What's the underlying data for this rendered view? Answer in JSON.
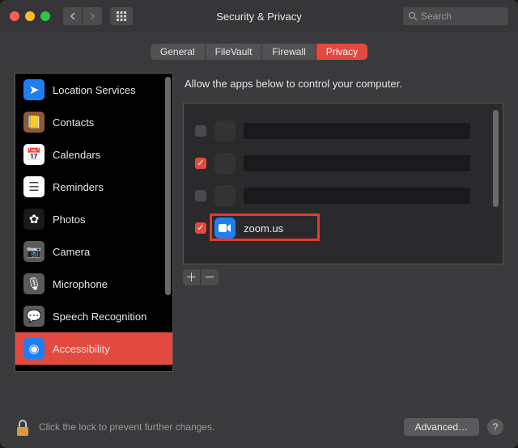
{
  "window": {
    "title": "Security & Privacy"
  },
  "search": {
    "placeholder": "Search"
  },
  "tabs": [
    {
      "id": "general",
      "label": "General",
      "active": false
    },
    {
      "id": "filevault",
      "label": "FileVault",
      "active": false
    },
    {
      "id": "firewall",
      "label": "Firewall",
      "active": false
    },
    {
      "id": "privacy",
      "label": "Privacy",
      "active": true
    }
  ],
  "sidebar": {
    "items": [
      {
        "id": "location",
        "label": "Location Services",
        "icon_bg": "#1f7ef0",
        "glyph": "➤"
      },
      {
        "id": "contacts",
        "label": "Contacts",
        "icon_bg": "#8a5a3a",
        "glyph": "📒"
      },
      {
        "id": "calendars",
        "label": "Calendars",
        "icon_bg": "#ffffff",
        "glyph": "📅"
      },
      {
        "id": "reminders",
        "label": "Reminders",
        "icon_bg": "#ffffff",
        "glyph": "☰"
      },
      {
        "id": "photos",
        "label": "Photos",
        "icon_bg": "#1a1a1a",
        "glyph": "✿"
      },
      {
        "id": "camera",
        "label": "Camera",
        "icon_bg": "#5a5a5c",
        "glyph": "📷"
      },
      {
        "id": "microphone",
        "label": "Microphone",
        "icon_bg": "#5a5a5c",
        "glyph": "🎙"
      },
      {
        "id": "speech",
        "label": "Speech Recognition",
        "icon_bg": "#5a5a5c",
        "glyph": "💬"
      },
      {
        "id": "accessibility",
        "label": "Accessibility",
        "icon_bg": "#1f7ef0",
        "glyph": "◉",
        "selected": true
      }
    ]
  },
  "main": {
    "description": "Allow the apps below to control your computer.",
    "apps": [
      {
        "checked": false,
        "redacted": true
      },
      {
        "checked": true,
        "redacted": true
      },
      {
        "checked": false,
        "redacted": true
      },
      {
        "checked": true,
        "name": "zoom.us",
        "icon_bg": "#1f7ef0",
        "highlighted": true
      }
    ]
  },
  "footer": {
    "lock_text": "Click the lock to prevent further changes.",
    "advanced_label": "Advanced…",
    "help_label": "?"
  }
}
